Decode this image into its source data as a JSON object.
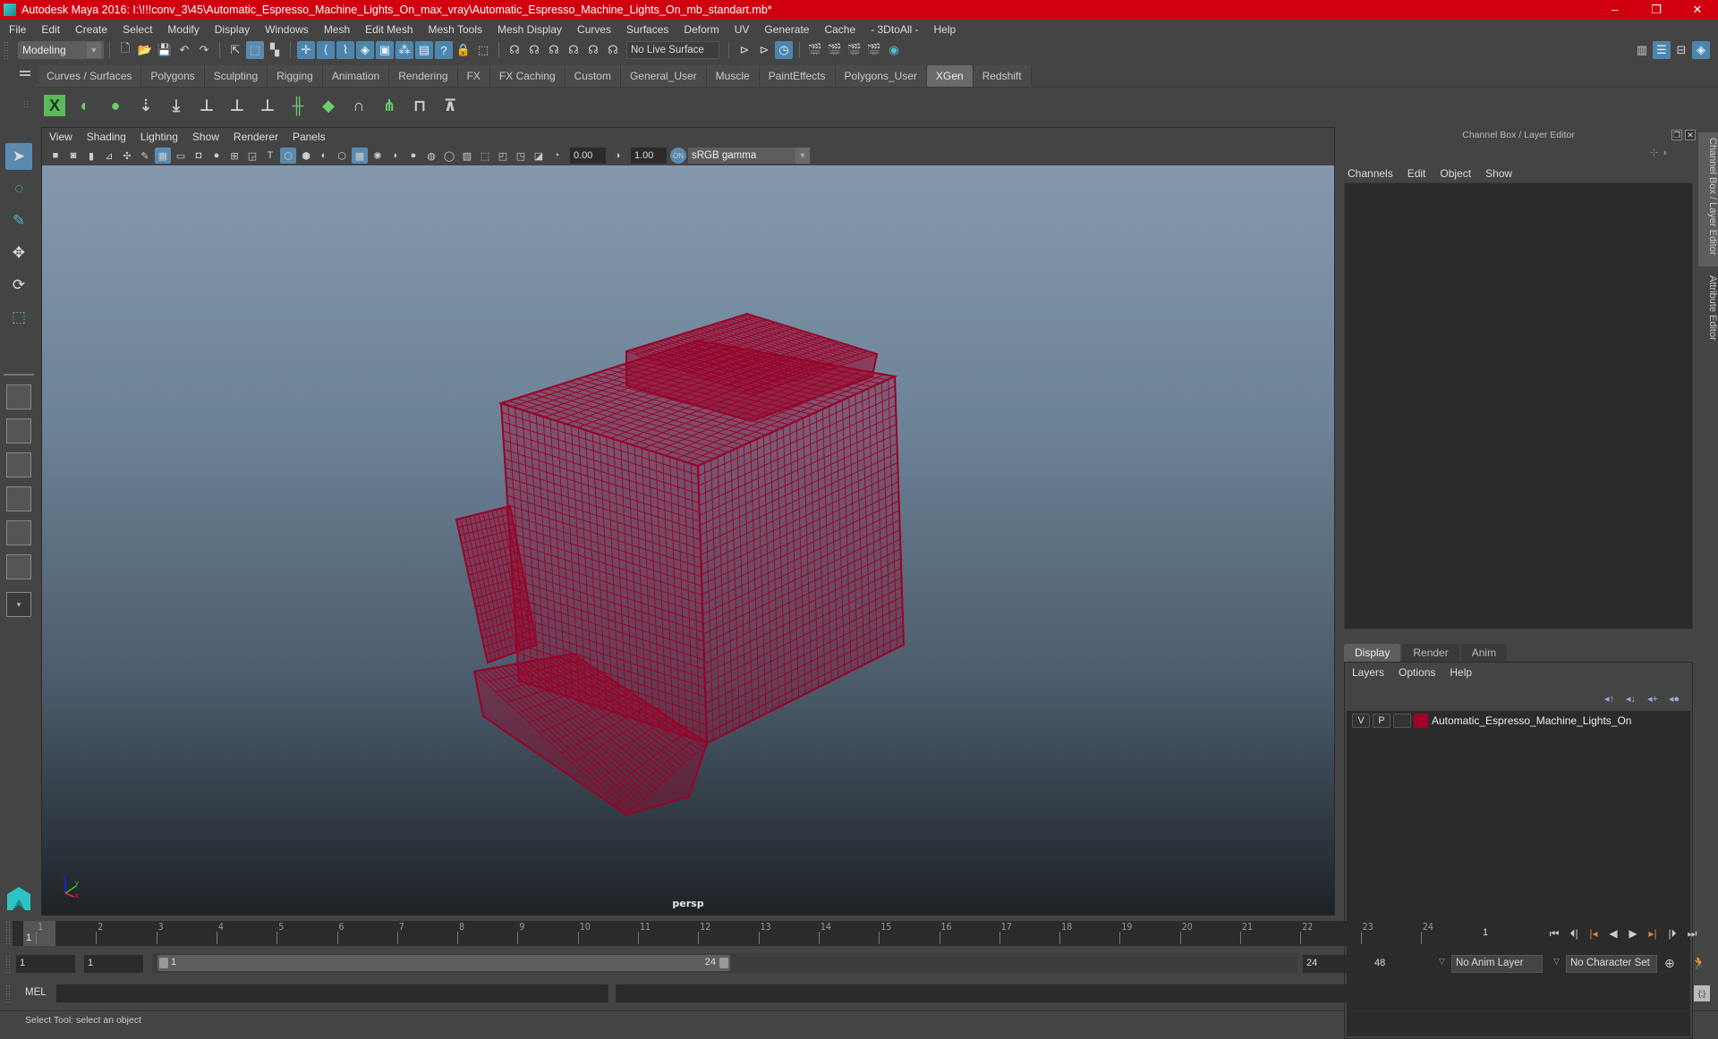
{
  "window": {
    "title": "Autodesk Maya 2016: I:\\!!!conv_3\\45\\Automatic_Espresso_Machine_Lights_On_max_vray\\Automatic_Espresso_Machine_Lights_On_mb_standart.mb*",
    "minimize": "–",
    "maximize": "❐",
    "close": "✕",
    "titlebar_color": "#d0000f"
  },
  "menubar": [
    "File",
    "Edit",
    "Create",
    "Select",
    "Modify",
    "Display",
    "Windows",
    "Mesh",
    "Edit Mesh",
    "Mesh Tools",
    "Mesh Display",
    "Curves",
    "Surfaces",
    "Deform",
    "UV",
    "Generate",
    "Cache",
    "- 3DtoAll -",
    "Help"
  ],
  "statusline": {
    "mode": "Modeling",
    "live_surface": "No Live Surface"
  },
  "shelf": {
    "tabs": [
      "Curves / Surfaces",
      "Polygons",
      "Sculpting",
      "Rigging",
      "Animation",
      "Rendering",
      "FX",
      "FX Caching",
      "Custom",
      "General_User",
      "Muscle",
      "PaintEffects",
      "Polygons_User",
      "XGen",
      "Redshift"
    ],
    "active_tab": "XGen",
    "icons": [
      "xgen-library-icon",
      "xgen-preview-icon",
      "xgen-clear-icon",
      "add-guides-icon",
      "sculpt-guides-icon",
      "place-guides-icon",
      "show-guides-icon",
      "lock-guides-icon",
      "rebuild-guides-icon",
      "ground-guides-icon",
      "convert-guides-icon",
      "select-guides-icon",
      "modify-guides-icon",
      "delete-guides-icon"
    ]
  },
  "panel": {
    "menu": [
      "View",
      "Shading",
      "Lighting",
      "Show",
      "Renderer",
      "Panels"
    ],
    "exposure": "0.00",
    "gamma": "1.00",
    "color_space": "sRGB gamma",
    "camera": "persp"
  },
  "axis": {
    "x": "x",
    "y": "y",
    "z": "z"
  },
  "channel_box": {
    "header": "Channel Box / Layer Editor",
    "menu": [
      "Channels",
      "Edit",
      "Object",
      "Show"
    ]
  },
  "layer_editor": {
    "tabs": [
      "Display",
      "Render",
      "Anim"
    ],
    "active_tab": "Display",
    "menu": [
      "Layers",
      "Options",
      "Help"
    ],
    "layers": [
      {
        "visible": "V",
        "playback": "P",
        "ref": "",
        "color": "#a0002a",
        "name": "Automatic_Espresso_Machine_Lights_On"
      }
    ]
  },
  "side_tabs": [
    "Channel Box / Layer Editor",
    "Attribute Editor"
  ],
  "timeline": {
    "ticks": [
      "1",
      "2",
      "3",
      "4",
      "5",
      "6",
      "7",
      "8",
      "9",
      "10",
      "11",
      "12",
      "13",
      "14",
      "15",
      "16",
      "17",
      "18",
      "19",
      "20",
      "21",
      "22",
      "23",
      "24"
    ],
    "current_frame": "1",
    "frame_field": "1"
  },
  "range": {
    "start": "1",
    "playback_start": "1",
    "range_start_label": "1",
    "range_end_label": "24",
    "playback_end": "24",
    "end": "48",
    "anim_layer": "No Anim Layer",
    "character_set": "No Character Set"
  },
  "command": {
    "label": "MEL",
    "help": "Select Tool: select an object"
  },
  "wireframe_color": "#9a0028"
}
